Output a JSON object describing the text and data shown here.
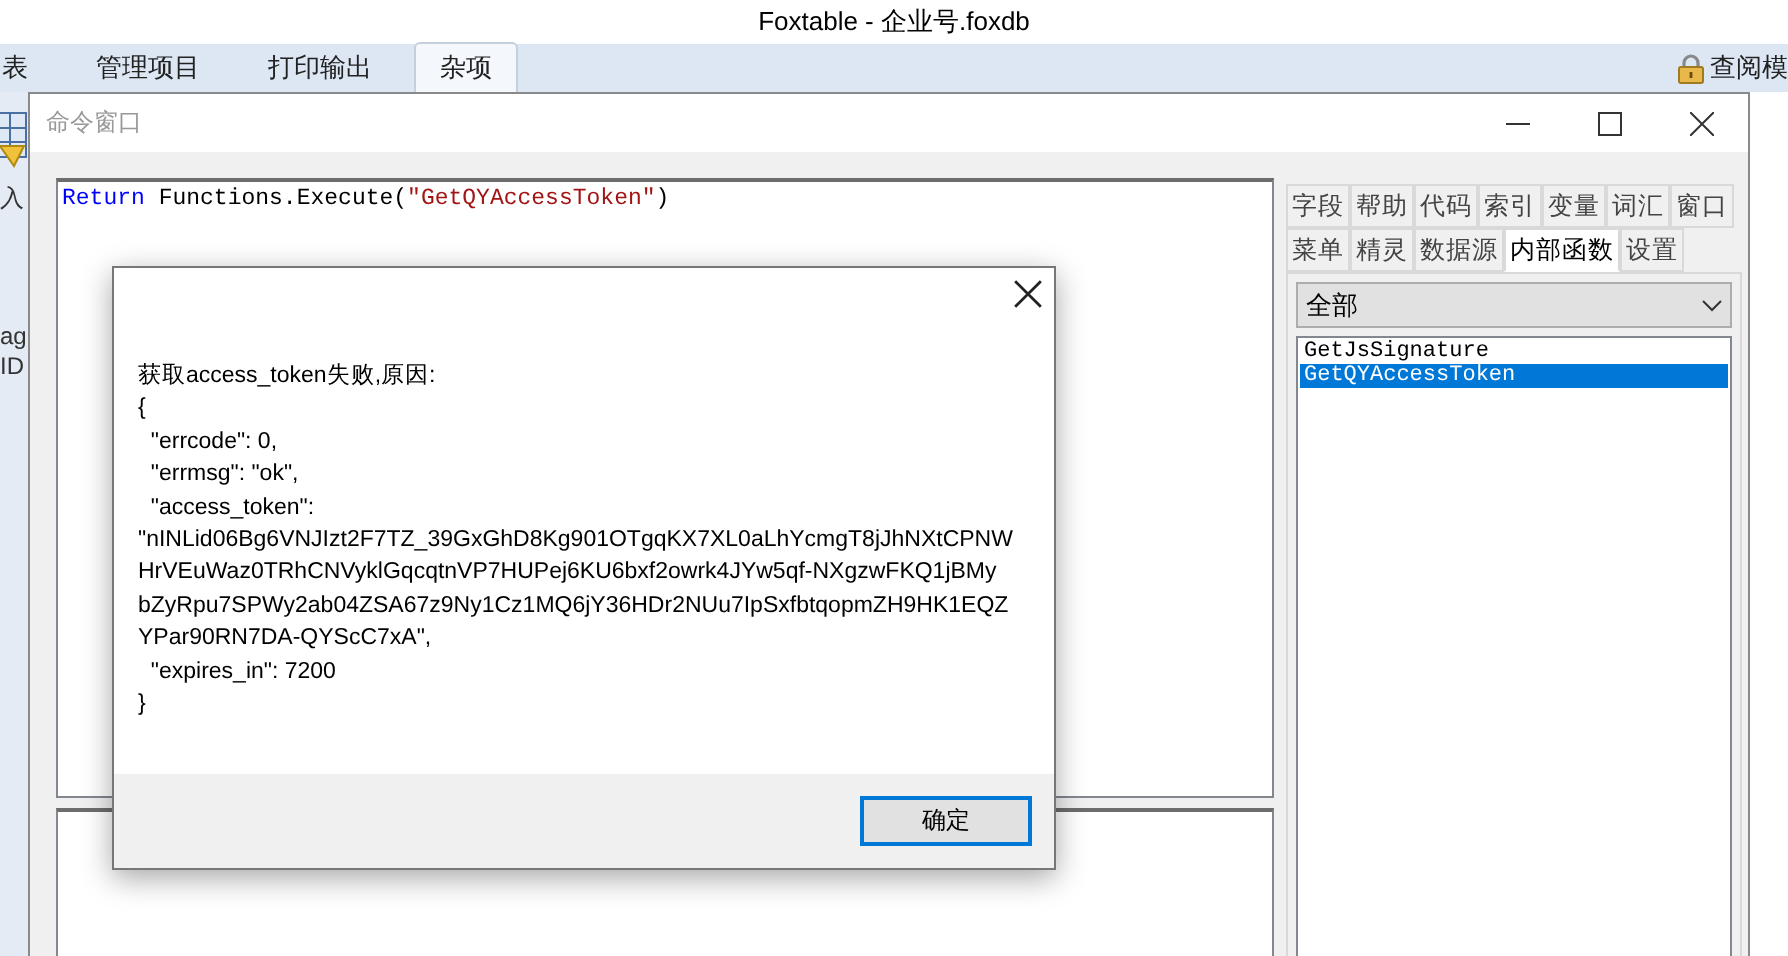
{
  "app_title": "Foxtable - 企业号.foxdb",
  "ribbon_tabs": [
    {
      "label": "表",
      "selected": false
    },
    {
      "label": "管理项目",
      "selected": false
    },
    {
      "label": "打印输出",
      "selected": false
    },
    {
      "label": "杂项",
      "selected": true
    }
  ],
  "mode_label": "查阅模",
  "background_texts": [
    "入",
    "ag",
    "ID"
  ],
  "command_window": {
    "title": "命令窗口",
    "code": [
      {
        "kind": "keyword",
        "text": "Return"
      },
      {
        "kind": "plain",
        "text": " Functions.Execute("
      },
      {
        "kind": "string",
        "text": "\"GetQYAccessToken\""
      },
      {
        "kind": "plain",
        "text": ")"
      }
    ],
    "side_tabs": [
      [
        {
          "label": "字段",
          "selected": false
        },
        {
          "label": "帮助",
          "selected": false
        },
        {
          "label": "代码",
          "selected": false
        },
        {
          "label": "索引",
          "selected": false
        },
        {
          "label": "变量",
          "selected": false
        },
        {
          "label": "词汇",
          "selected": false
        },
        {
          "label": "窗口",
          "selected": false
        }
      ],
      [
        {
          "label": "菜单",
          "selected": false
        },
        {
          "label": "精灵",
          "selected": false
        },
        {
          "label": "数据源",
          "selected": false
        },
        {
          "label": "内部函数",
          "selected": true
        },
        {
          "label": "设置",
          "selected": false
        }
      ]
    ],
    "filter": "全部",
    "functions": [
      {
        "label": "GetJsSignature",
        "selected": false
      },
      {
        "label": "GetQYAccessToken",
        "selected": true
      }
    ]
  },
  "dialog": {
    "message": "获取access_token失败,原因:\n{\n  \"errcode\": 0,\n  \"errmsg\": \"ok\",\n  \"access_token\":\n\"nINLid06Bg6VNJIzt2F7TZ_39GxGhD8Kg901OTgqKX7XL0aLhYcmgT8jJhNXtCPNW\nHrVEuWaz0TRhCNVyklGqcqtnVP7HUPej6KU6bxf2owrk4JYw5qf-NXgzwFKQ1jBMy\nbZyRpu7SPWy2ab04ZSA67z9Ny1Cz1MQ6jY36HDr2NUu7IpSxfbtqopmZH9HK1EQZ\nYPar90RN7DA-QYScC7xA\",\n  \"expires_in\": 7200\n}",
    "ok_button": "确定"
  }
}
